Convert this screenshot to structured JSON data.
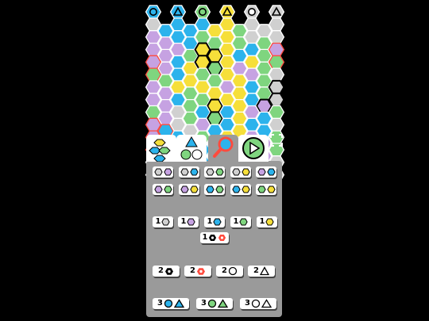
{
  "colors": {
    "purple": "#c6a2e2",
    "blue": "#2cb3ec",
    "green": "#7fd57f",
    "yellow": "#f6df3a",
    "gray": "#d0d0d0",
    "panel": "#9a9a9a",
    "bg": "#000000",
    "red": "#ff4b3e"
  },
  "header_symbols": [
    {
      "shape": "circle",
      "fill": "blue"
    },
    {
      "shape": "triangle",
      "fill": "blue"
    },
    {
      "shape": "circle",
      "fill": "green"
    },
    {
      "shape": "triangle",
      "fill": "yellow"
    },
    {
      "shape": "circle",
      "fill": "white"
    },
    {
      "shape": "triangle",
      "fill": "gray"
    }
  ],
  "board_rows": [
    "XBBBBYYGXXX",
    "PPBBGGYGXGX",
    "PPPGYYYBBGP",
    "PPBYYGYPYGG",
    "GGBYGGYYPGX",
    "PPYGYYPYBGX",
    "PPBGGYYYBPX",
    "GPXGBGBYPBG",
    "PBXXPBBYBBX",
    "PGBPGBYXPPG",
    "PXPYBPPBXPG",
    "XXGXBXGBBGX",
    "XXXXXXXXXXX"
  ],
  "tabs": [
    {
      "name": "tab-colors",
      "selected": false
    },
    {
      "name": "tab-shapes",
      "selected": false
    },
    {
      "name": "tab-search",
      "selected": true
    },
    {
      "name": "tab-play",
      "selected": false
    }
  ],
  "color_pair_rows": [
    [
      [
        "gray",
        "purple"
      ],
      [
        "gray",
        "blue"
      ],
      [
        "gray",
        "green"
      ],
      [
        "gray",
        "yellow"
      ],
      [
        "purple",
        "blue"
      ]
    ],
    [
      [
        "purple",
        "green"
      ],
      [
        "purple",
        "yellow"
      ],
      [
        "blue",
        "green"
      ],
      [
        "blue",
        "yellow"
      ],
      [
        "green",
        "yellow"
      ]
    ]
  ],
  "count_color_tiles": [
    {
      "count": "1",
      "color": "gray"
    },
    {
      "count": "1",
      "color": "purple"
    },
    {
      "count": "1",
      "color": "blue"
    },
    {
      "count": "1",
      "color": "green"
    },
    {
      "count": "1",
      "color": "yellow"
    }
  ],
  "special_tile": {
    "count": "1"
  },
  "count_shape_tiles": [
    {
      "count": "2",
      "icon": "hex-black"
    },
    {
      "count": "2",
      "icon": "hex-red"
    },
    {
      "count": "2",
      "icon": "circle"
    },
    {
      "count": "2",
      "icon": "triangle"
    }
  ],
  "count_pair_tiles": [
    {
      "count": "3",
      "fill": "blue"
    },
    {
      "count": "3",
      "fill": "green"
    },
    {
      "count": "3",
      "fill": "white"
    }
  ]
}
